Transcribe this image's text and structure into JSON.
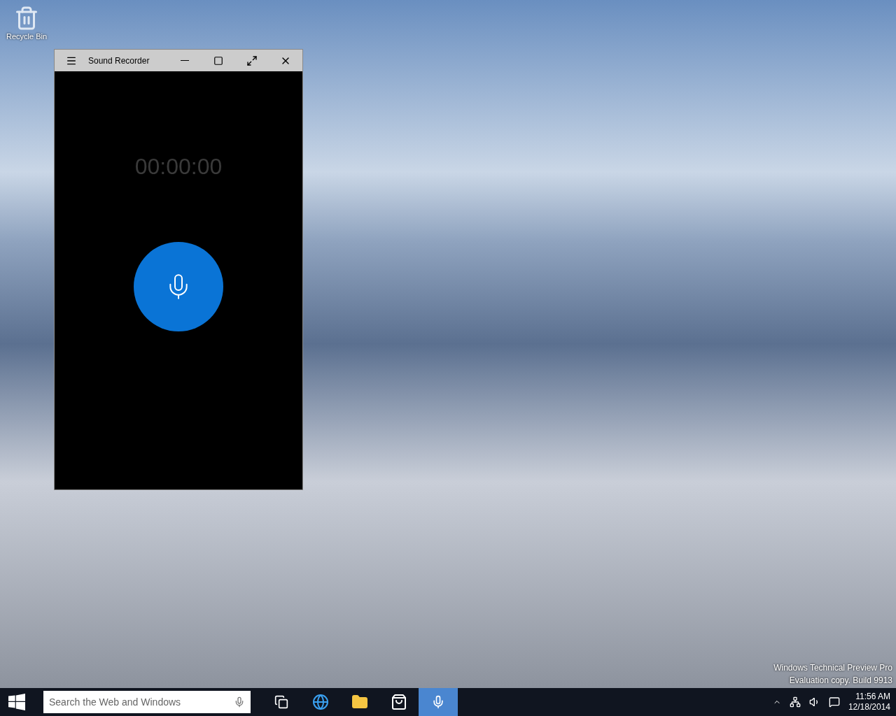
{
  "desktop": {
    "icons": [
      {
        "label": "Recycle Bin"
      }
    ],
    "edition_notice": [
      "Windows Technical Preview Pro",
      "Evaluation copy. Build 9913"
    ]
  },
  "window": {
    "title": "Sound Recorder",
    "timer": "00:00:00"
  },
  "taskbar": {
    "search": {
      "placeholder": "Search the Web and Windows"
    },
    "apps": [
      {
        "kind": "taskview",
        "selected": false
      },
      {
        "kind": "browser",
        "selected": false
      },
      {
        "kind": "folder",
        "selected": false
      },
      {
        "kind": "store",
        "selected": false
      },
      {
        "kind": "recorder",
        "selected": true
      }
    ],
    "clock": {
      "time": "11:56 AM",
      "date": "12/18/2014"
    }
  }
}
